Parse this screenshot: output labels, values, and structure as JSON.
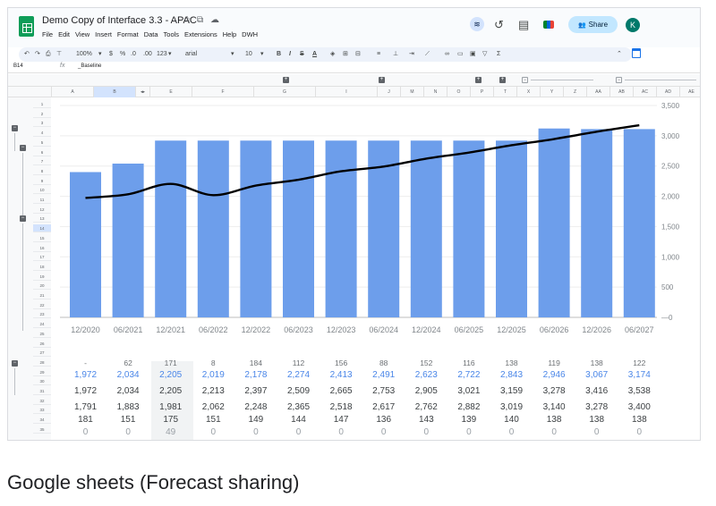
{
  "app": {
    "doc_title": "Demo Copy of Interface 3.3 - APAC",
    "menu": [
      "File",
      "Edit",
      "View",
      "Insert",
      "Format",
      "Data",
      "Tools",
      "Extensions",
      "Help",
      "DWH"
    ],
    "share_label": "Share",
    "avatar_initial": "K",
    "brand_color": "#0f9d58",
    "accent_color": "#c2e7ff"
  },
  "toolbar": {
    "zoom": "100%",
    "currency": "$",
    "percent": "%",
    "decrease_decimals": ".0",
    "increase_decimals": ".00",
    "number_format": "123",
    "font": "arial",
    "font_size": "10",
    "bold": "B",
    "italic": "I",
    "strikethrough": "S",
    "text_color": "A"
  },
  "formula_bar": {
    "cell_ref": "B14",
    "fx": "fx",
    "value": "_Baseline"
  },
  "grid": {
    "columns": [
      "A",
      "B",
      "E",
      "F",
      "G",
      "I",
      "J",
      "M",
      "N",
      "O",
      "P",
      "T",
      "X",
      "Y",
      "Z",
      "AA",
      "AB",
      "AC",
      "AD",
      "AE"
    ],
    "selected_column": "B",
    "selected_row": "14",
    "rows": [
      "1",
      "2",
      "3",
      "4",
      "5",
      "6",
      "7",
      "8",
      "9",
      "10",
      "11",
      "12",
      "13",
      "14",
      "15",
      "16",
      "17",
      "18",
      "19",
      "20",
      "21",
      "22",
      "23",
      "24",
      "25",
      "26",
      "27",
      "28",
      "29",
      "30",
      "31",
      "32",
      "33",
      "34",
      "35"
    ]
  },
  "chart_data": {
    "type": "bar",
    "title": "",
    "categories": [
      "12/2020",
      "06/2021",
      "12/2021",
      "06/2022",
      "12/2022",
      "06/2023",
      "12/2023",
      "06/2024",
      "12/2024",
      "06/2025",
      "12/2025",
      "06/2026",
      "12/2026",
      "06/2027"
    ],
    "series": [
      {
        "type": "bar",
        "color": "#6d9eeb",
        "values": [
          2400,
          2540,
          2920,
          2920,
          2920,
          2920,
          2920,
          2920,
          2920,
          2920,
          2920,
          3120,
          3110,
          3110
        ]
      },
      {
        "type": "line",
        "color": "#000000",
        "values": [
          1972,
          2034,
          2205,
          2019,
          2178,
          2274,
          2413,
          2491,
          2623,
          2722,
          2843,
          2946,
          3067,
          3174
        ]
      }
    ],
    "ylim": [
      0,
      3500
    ],
    "yticks": [
      "0",
      "500",
      "1,000",
      "1,500",
      "2,000",
      "2,500",
      "3,000",
      "3,500"
    ],
    "y_axis_side": "right",
    "grid": true,
    "legend": "none"
  },
  "table": {
    "row_a": [
      "-",
      "62",
      "171",
      "8",
      "184",
      "112",
      "156",
      "88",
      "152",
      "116",
      "138",
      "119",
      "138",
      "122"
    ],
    "row_b": [
      "1,972",
      "2,034",
      "2,205",
      "2,019",
      "2,178",
      "2,274",
      "2,413",
      "2,491",
      "2,623",
      "2,722",
      "2,843",
      "2,946",
      "3,067",
      "3,174"
    ],
    "row_c": [
      "1,972",
      "2,034",
      "2,205",
      "2,213",
      "2,397",
      "2,509",
      "2,665",
      "2,753",
      "2,905",
      "3,021",
      "3,159",
      "3,278",
      "3,416",
      "3,538"
    ],
    "row_d": [
      "1,791",
      "1,883",
      "1,981",
      "2,062",
      "2,248",
      "2,365",
      "2,518",
      "2,617",
      "2,762",
      "2,882",
      "3,019",
      "3,140",
      "3,278",
      "3,400"
    ],
    "row_e": [
      "181",
      "151",
      "175",
      "151",
      "149",
      "144",
      "147",
      "136",
      "143",
      "139",
      "140",
      "138",
      "138",
      "138"
    ],
    "row_f": [
      "0",
      "0",
      "49",
      "0",
      "0",
      "0",
      "0",
      "0",
      "0",
      "0",
      "0",
      "0",
      "0",
      "0"
    ]
  },
  "caption": "Google sheets (Forecast sharing)"
}
